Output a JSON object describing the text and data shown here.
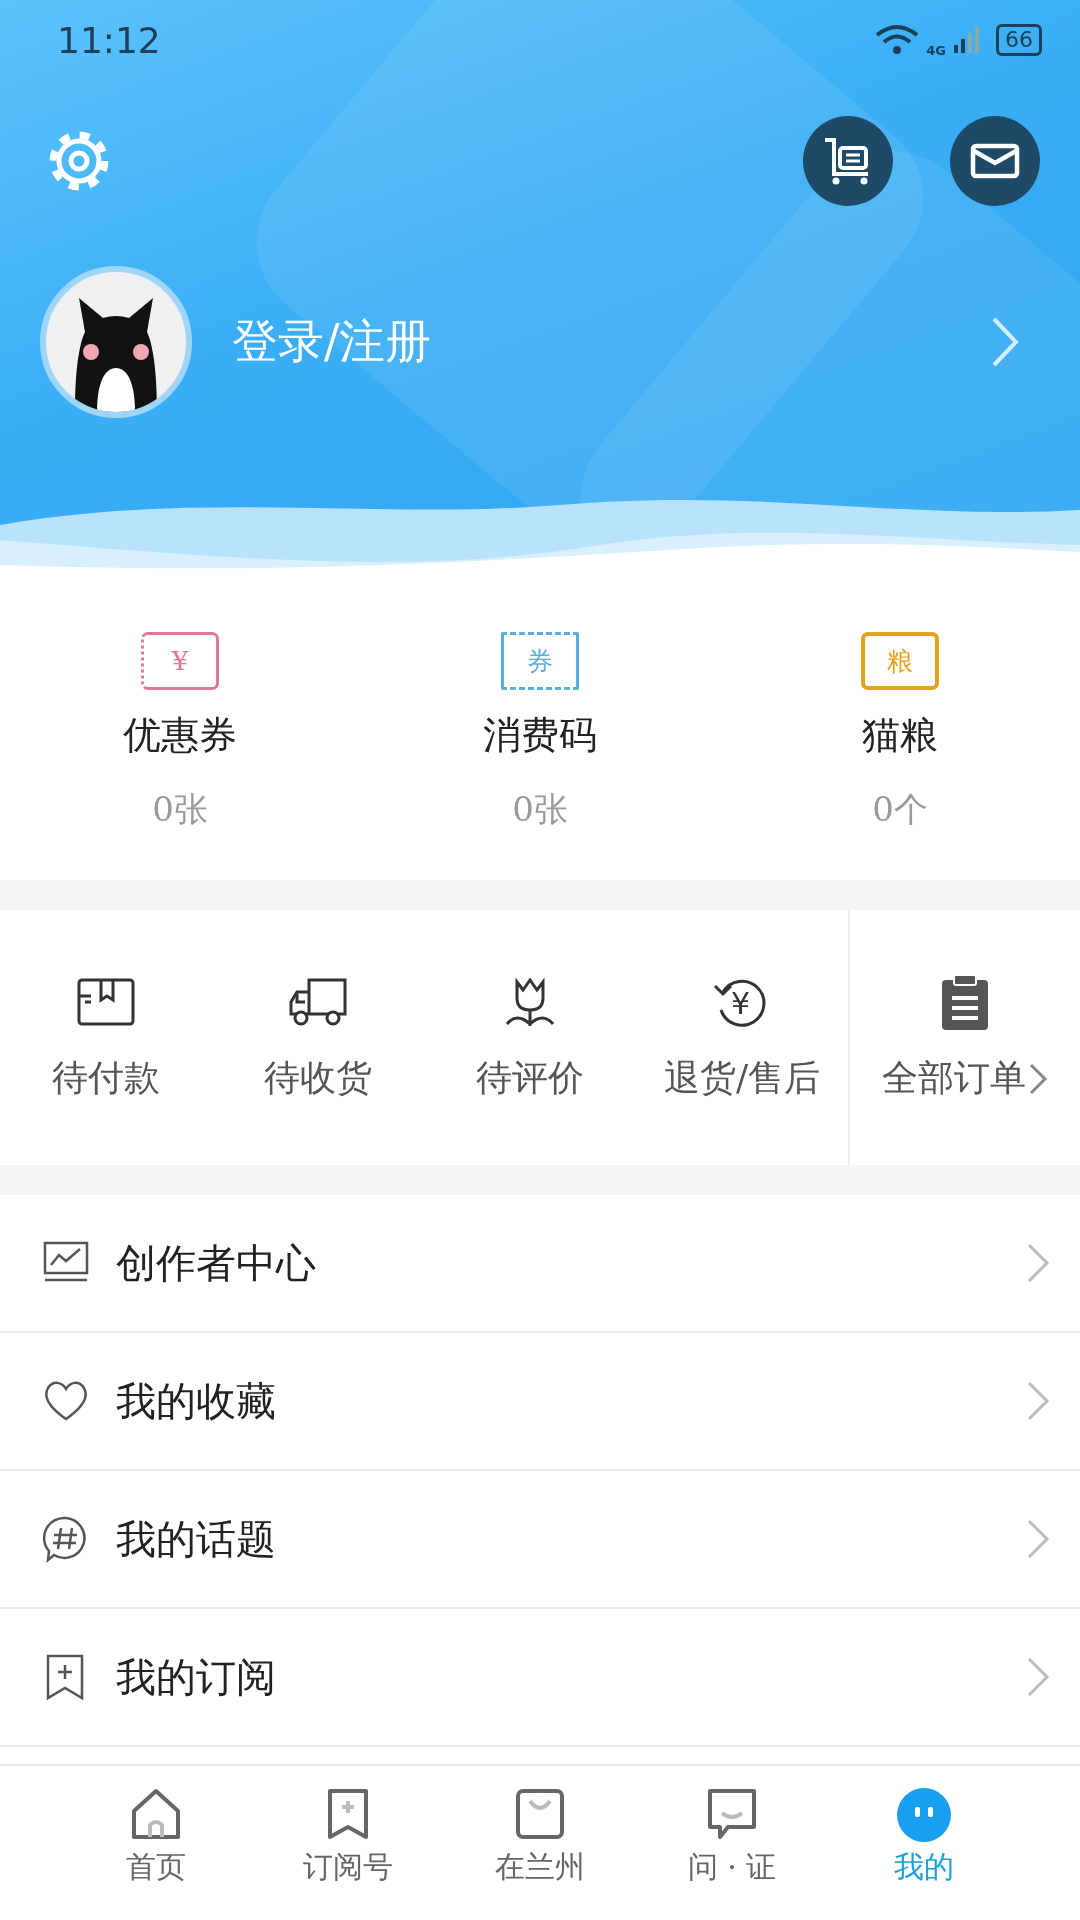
{
  "status_bar": {
    "time": "11:12",
    "network": "4G",
    "battery": "66"
  },
  "profile": {
    "login_text": "登录/注册"
  },
  "stats": [
    {
      "kind": "coupon",
      "icon_text": "¥",
      "color": "#e07a94",
      "label": "优惠券",
      "count": "0张"
    },
    {
      "kind": "code",
      "icon_text": "券",
      "color": "#5ab0d8",
      "label": "消费码",
      "count": "0张"
    },
    {
      "kind": "food",
      "icon_text": "粮",
      "color": "#e0a020",
      "label": "猫粮",
      "count": "0个"
    }
  ],
  "orders": [
    {
      "kind": "box",
      "label": "待付款"
    },
    {
      "kind": "truck",
      "label": "待收货"
    },
    {
      "kind": "flower",
      "label": "待评价"
    },
    {
      "kind": "refund",
      "label": "退货/售后",
      "icon_text": "¥"
    },
    {
      "kind": "all",
      "label": "全部订单"
    }
  ],
  "menu": [
    {
      "kind": "chart",
      "label": "创作者中心"
    },
    {
      "kind": "heart",
      "label": "我的收藏"
    },
    {
      "kind": "topic",
      "label": "我的话题"
    },
    {
      "kind": "bookmark",
      "label": "我的订阅"
    }
  ],
  "tabs": [
    {
      "kind": "home",
      "label": "首页",
      "selected": false
    },
    {
      "kind": "bookmark",
      "label": "订阅号",
      "selected": false
    },
    {
      "kind": "bag",
      "label": "在兰州",
      "selected": false
    },
    {
      "kind": "chat",
      "label": "问 · 证",
      "selected": false
    },
    {
      "kind": "face",
      "label": "我的",
      "selected": true
    }
  ]
}
